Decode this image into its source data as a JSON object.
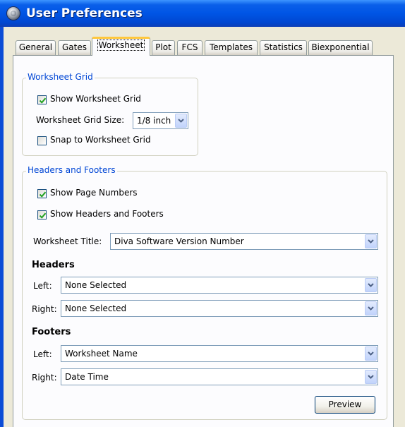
{
  "window": {
    "title": "User Preferences"
  },
  "tabs": [
    {
      "label": "General"
    },
    {
      "label": "Gates"
    },
    {
      "label": "Worksheet",
      "active": true
    },
    {
      "label": "Plot"
    },
    {
      "label": "FCS"
    },
    {
      "label": "Templates"
    },
    {
      "label": "Statistics"
    },
    {
      "label": "Biexponential"
    }
  ],
  "worksheet_grid": {
    "legend": "Worksheet Grid",
    "show_grid": {
      "label": "Show Worksheet Grid",
      "checked": true
    },
    "grid_size": {
      "label": "Worksheet Grid Size:",
      "value": "1/8 inch"
    },
    "snap": {
      "label": "Snap to Worksheet Grid",
      "checked": false
    }
  },
  "headers_footers": {
    "legend": "Headers and Footers",
    "show_page_numbers": {
      "label": "Show Page Numbers",
      "checked": true
    },
    "show_headers_footers": {
      "label": "Show Headers and Footers",
      "checked": true
    },
    "worksheet_title": {
      "label": "Worksheet Title:",
      "value": "Diva Software Version Number"
    },
    "headers": {
      "heading": "Headers",
      "left": {
        "label": "Left:",
        "value": "None Selected"
      },
      "right": {
        "label": "Right:",
        "value": "None Selected"
      }
    },
    "footers": {
      "heading": "Footers",
      "left": {
        "label": "Left:",
        "value": "Worksheet Name"
      },
      "right": {
        "label": "Right:",
        "value": "Date Time"
      }
    },
    "preview_label": "Preview"
  },
  "colors": {
    "titlebar": "#0055e5",
    "legend_text": "#0046d5",
    "active_tab_accent": "#ffc73c",
    "check": "#21a121"
  },
  "icons": {
    "app": "app-orb-icon",
    "check": "checkmark-icon",
    "dropdown": "chevron-down-icon"
  }
}
